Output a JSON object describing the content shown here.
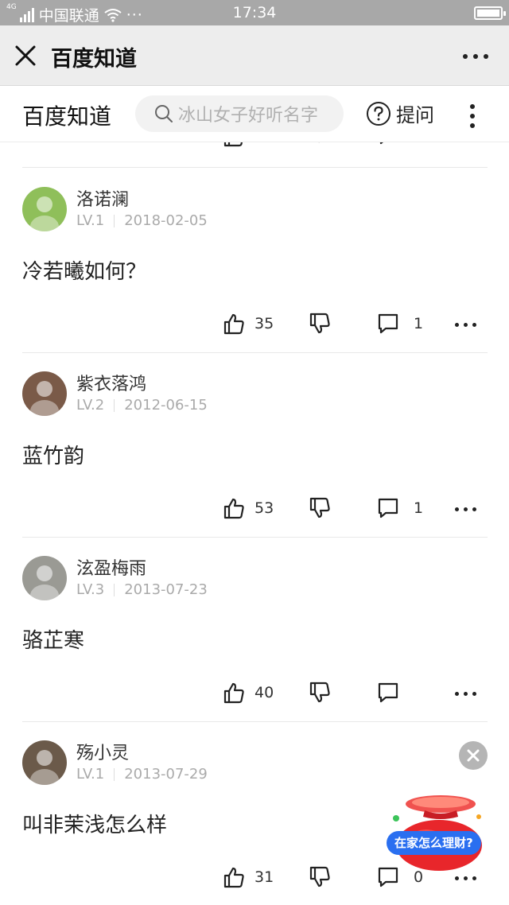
{
  "status_bar": {
    "network_type": "4G",
    "carrier": "中国联通",
    "time": "17:34"
  },
  "wechat_bar": {
    "title": "百度知道"
  },
  "zhidao_bar": {
    "brand": "百度知道",
    "search_placeholder": "冰山女子好听名字",
    "ask_label": "提问"
  },
  "answers": [
    {
      "username": "洛诺澜",
      "level": "LV.1",
      "date": "2018-02-05",
      "content": "冷若曦如何？",
      "likes": "35",
      "comments": "1",
      "avatar_color": "#8fbf5a"
    },
    {
      "username": "紫衣落鸿",
      "level": "LV.2",
      "date": "2012-06-15",
      "content": "蓝竹韵",
      "likes": "53",
      "comments": "1",
      "avatar_color": "#7a5a48"
    },
    {
      "username": "泫盈梅雨",
      "level": "LV.3",
      "date": "2013-07-23",
      "content": "骆芷寒",
      "likes": "40",
      "comments": "",
      "avatar_color": "#9a9a94"
    },
    {
      "username": "殇小灵",
      "level": "LV.1",
      "date": "2013-07-29",
      "content": "叫非茉浅怎么样",
      "likes": "31",
      "comments": "0",
      "avatar_color": "#6b5a4a"
    }
  ],
  "float_ad": {
    "label": "在家怎么理财?"
  },
  "colors": {
    "status_bar_bg": "#a8a8a8",
    "wechat_bar_bg": "#ededed",
    "ad_blue": "#2a6ff0",
    "ad_red": "#e8262b"
  }
}
